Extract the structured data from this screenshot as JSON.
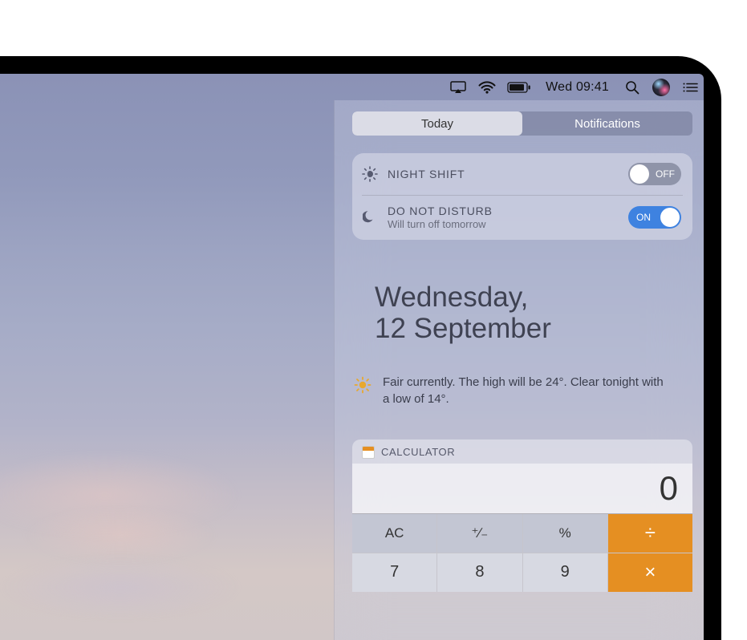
{
  "colors": {
    "accent_blue": "#3e82e0",
    "calc_orange": "#e58f22"
  },
  "menubar": {
    "clock": "Wed 09:41",
    "icons": {
      "airplay": "airplay-icon",
      "wifi": "wifi-icon",
      "battery": "battery-icon",
      "search": "search-icon",
      "siri": "siri-icon",
      "nc": "notification-center-icon"
    }
  },
  "segmented": {
    "today": "Today",
    "notifications": "Notifications"
  },
  "toggles": {
    "night_shift": {
      "title": "NIGHT SHIFT",
      "state_label": "OFF",
      "on": false,
      "icon": "night-shift-icon"
    },
    "dnd": {
      "title": "DO NOT DISTURB",
      "subtitle": "Will turn off tomorrow",
      "state_label": "ON",
      "on": true,
      "icon": "moon-icon"
    }
  },
  "date": {
    "line1": "Wednesday,",
    "line2": "12 September"
  },
  "weather": {
    "icon": "sun-icon",
    "text": "Fair currently. The high will be 24°. Clear tonight with a low of 14°."
  },
  "calculator": {
    "title": "CALCULATOR",
    "icon": "calculator-app-icon",
    "display": "0",
    "rows": [
      [
        {
          "label": "AC",
          "kind": "fn"
        },
        {
          "label": "⁺∕₋",
          "kind": "fn"
        },
        {
          "label": "%",
          "kind": "fn"
        },
        {
          "label": "÷",
          "kind": "op"
        }
      ],
      [
        {
          "label": "7",
          "kind": "num"
        },
        {
          "label": "8",
          "kind": "num"
        },
        {
          "label": "9",
          "kind": "num"
        },
        {
          "label": "×",
          "kind": "op"
        }
      ]
    ]
  }
}
